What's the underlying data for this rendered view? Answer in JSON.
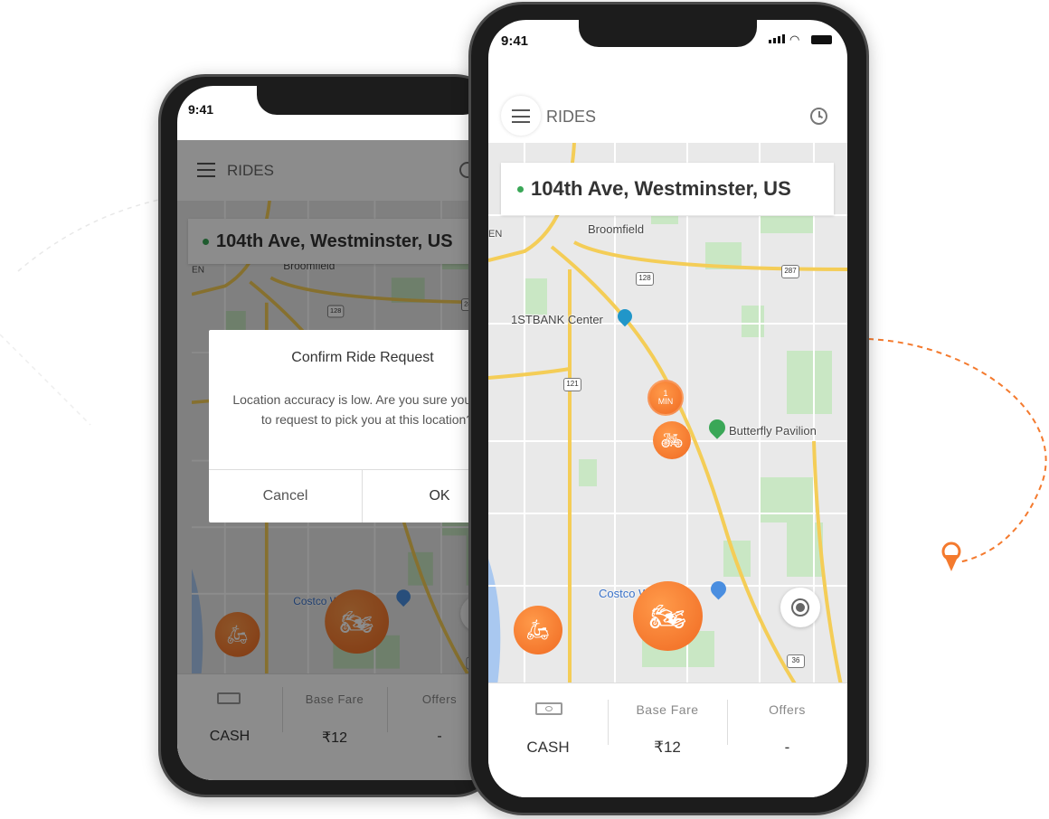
{
  "status_bar": {
    "time": "9:41"
  },
  "header": {
    "title": "RIDES",
    "menu_icon": "hamburger-icon",
    "history_icon": "clock-icon"
  },
  "address": {
    "text": "104th Ave, Westminster, US",
    "dot_color": "#3aa757"
  },
  "map": {
    "labels": {
      "broomfield": "Broomfield",
      "stbank": "1STBANK Center",
      "butterfly": "Butterfly Pavilion",
      "costco": "Costco Wholesale",
      "en": "EN"
    },
    "shields": {
      "s128": "128",
      "s287": "287",
      "s121": "121",
      "s36": "36"
    },
    "eta_pin": {
      "line1": "1",
      "line2": "MIN"
    },
    "accent": "#f47a2e"
  },
  "bottom_bar": {
    "payment": {
      "icon": "cash-icon",
      "value": "CASH"
    },
    "base_fare": {
      "label": "Base Fare",
      "value": "₹12"
    },
    "offers": {
      "label": "Offers",
      "value": "-"
    }
  },
  "dialog": {
    "title": "Confirm Ride Request",
    "message": "Location accuracy is low. Are you sure you want to request to pick you at this location?",
    "cancel": "Cancel",
    "ok": "OK"
  }
}
